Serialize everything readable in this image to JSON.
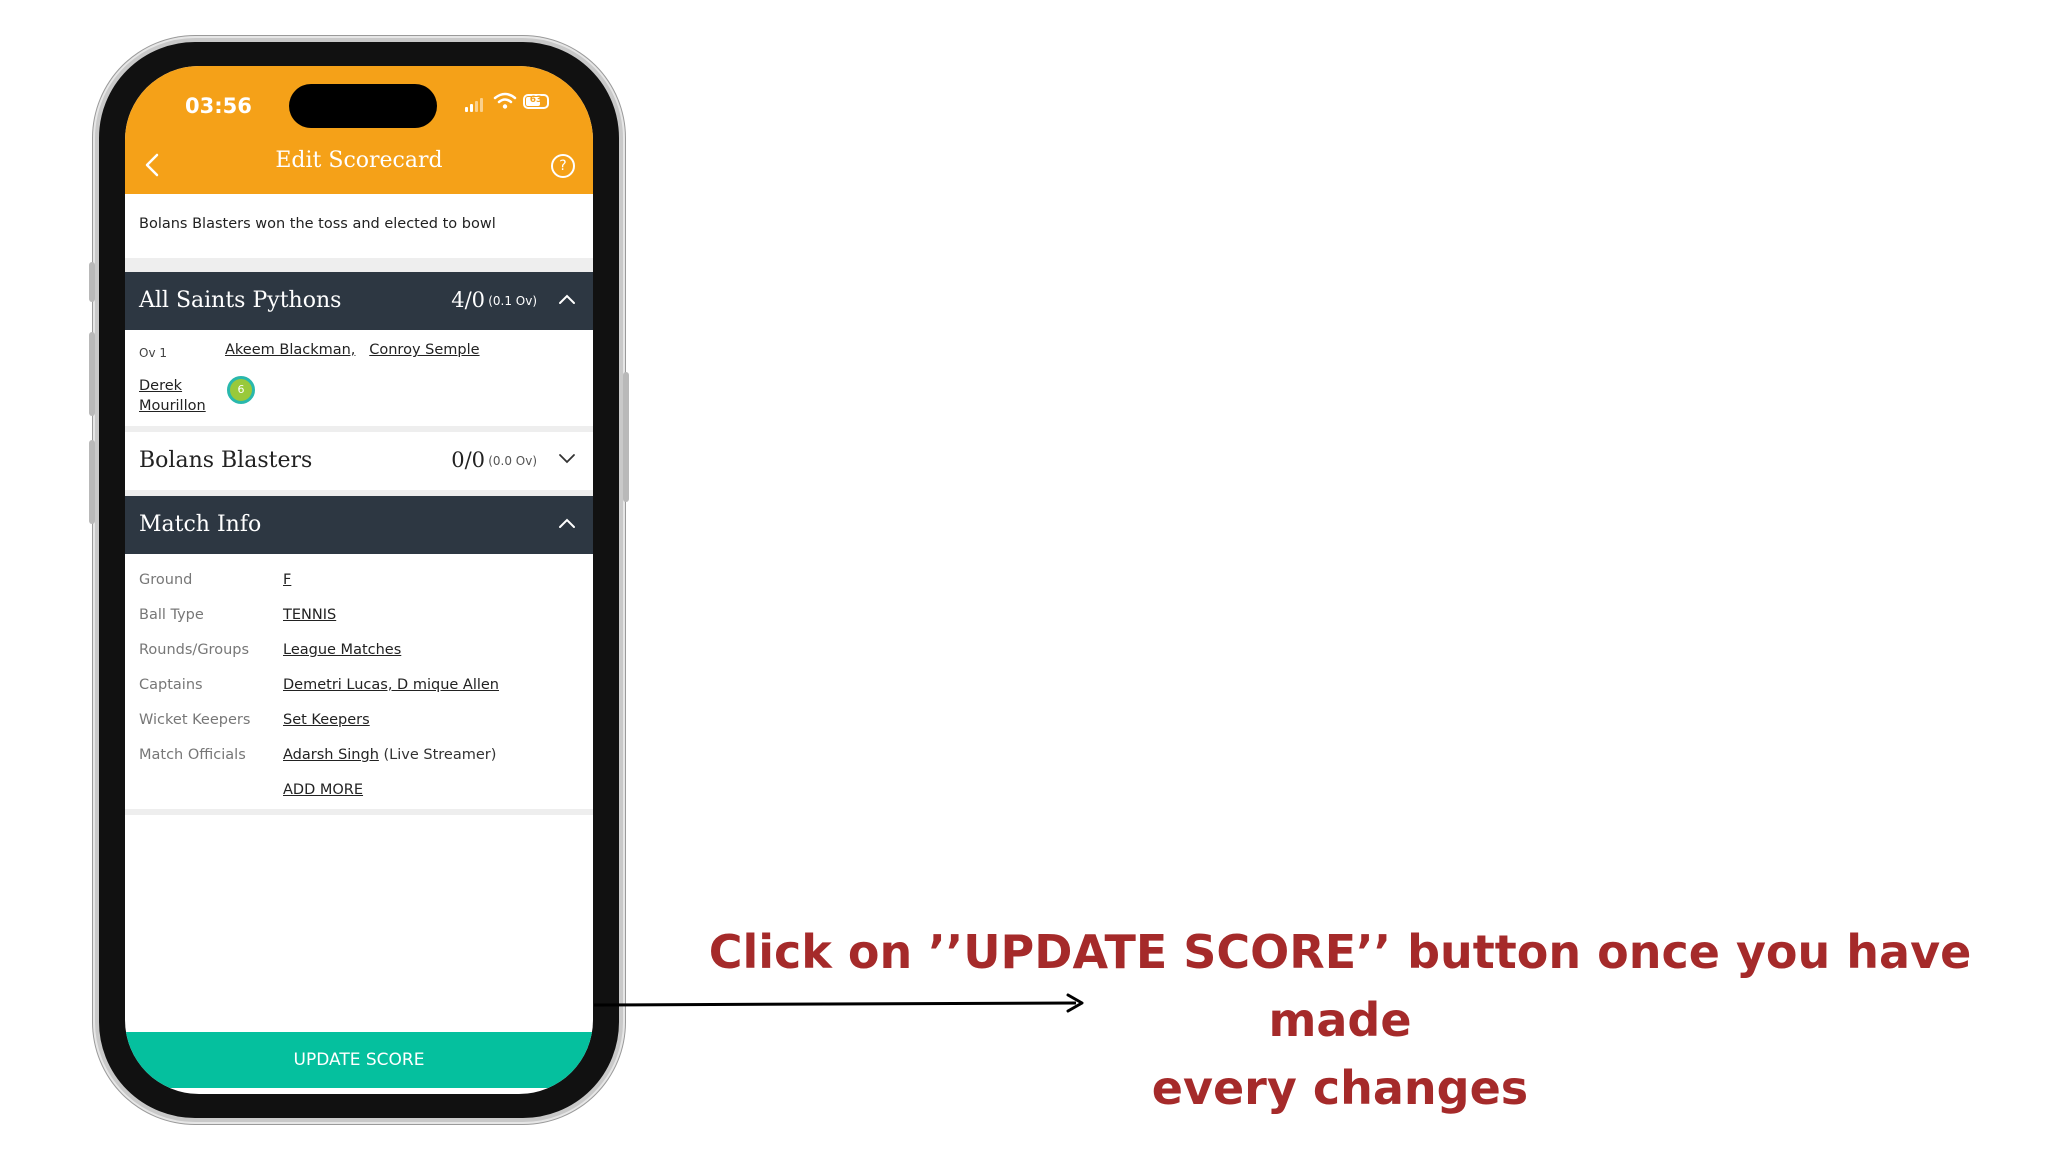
{
  "status": {
    "time": "03:56",
    "battery": "63"
  },
  "header": {
    "title": "Edit Scorecard",
    "help_label": "?"
  },
  "toss_text": "Bolans Blasters won the toss and elected to bowl",
  "innings": [
    {
      "team": "All Saints Pythons",
      "score": "4/0",
      "overs": "(0.1 Ov)",
      "expanded": true,
      "over_label": "Ov 1",
      "batsmen": [
        "Akeem Blackman,",
        "Conroy Semple"
      ],
      "bowler": "Derek Mourillon",
      "ball": "6"
    },
    {
      "team": "Bolans Blasters",
      "score": "0/0",
      "overs": "(0.0 Ov)",
      "expanded": false
    }
  ],
  "match_info": {
    "title": "Match Info",
    "rows": [
      {
        "label": "Ground",
        "value": "F"
      },
      {
        "label": "Ball Type",
        "value": "TENNIS"
      },
      {
        "label": "Rounds/Groups",
        "value": "League Matches"
      },
      {
        "label": "Captains",
        "value": "Demetri Lucas, D mique Allen"
      },
      {
        "label": "Wicket Keepers",
        "value": "Set Keepers"
      },
      {
        "label": "Match Officials",
        "value": "Adarsh Singh",
        "note": "(Live Streamer)"
      }
    ],
    "add_more": "ADD MORE"
  },
  "update_button": "UPDATE SCORE",
  "instruction": {
    "line1": "Click on ’’UPDATE SCORE’’ button once you have made",
    "line2": "every changes"
  },
  "colors": {
    "header": "#f5a118",
    "dark_bar": "#2d3742",
    "button": "#05c09e",
    "instruction": "#a52a2a"
  }
}
